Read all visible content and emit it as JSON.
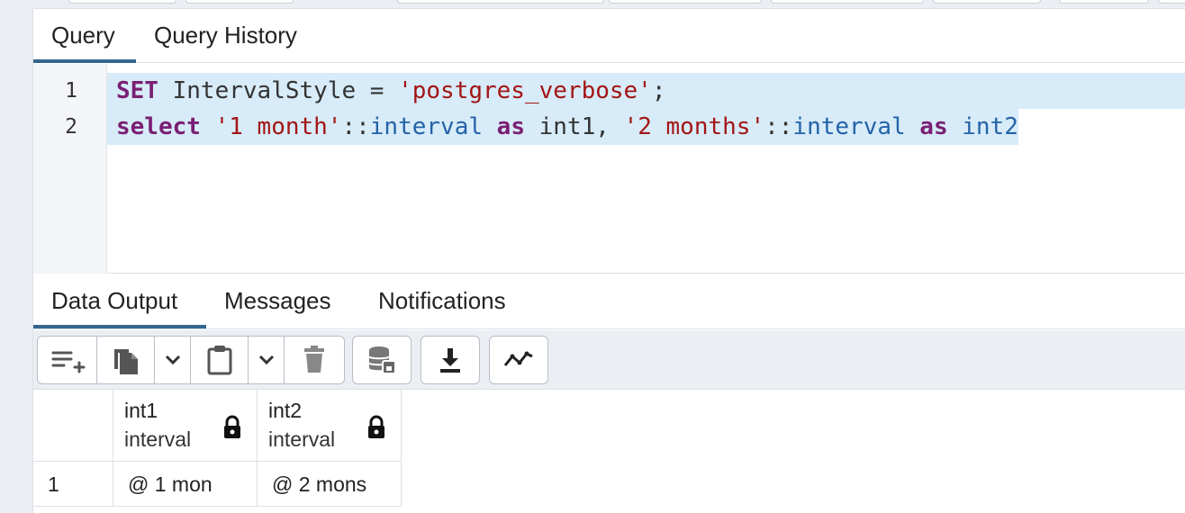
{
  "query_tabs": [
    {
      "label": "Query",
      "active": true
    },
    {
      "label": "Query History",
      "active": false
    }
  ],
  "editor": {
    "line_numbers": [
      "1",
      "2"
    ],
    "line1": {
      "kw": "SET",
      "ident": " IntervalStyle = ",
      "str": "'postgres_verbose'",
      "end": ";"
    },
    "line2": {
      "kw1": "select",
      "str1": " '1 month'",
      "op1": "::",
      "typ1": "interval",
      "kw2": " as",
      "ident1": " int1, ",
      "str2": "'2 months'",
      "op2": "::",
      "typ2": "interval",
      "kw3": " as",
      "typ3": " int2"
    }
  },
  "result_tabs": [
    {
      "label": "Data Output",
      "active": true
    },
    {
      "label": "Messages",
      "active": false
    },
    {
      "label": "Notifications",
      "active": false
    }
  ],
  "toolbar": {
    "icons": [
      "add-row-icon",
      "copy-icon",
      "chevron-down-icon",
      "paste-icon",
      "chevron-down-icon",
      "delete-icon",
      "save-data-icon",
      "download-icon",
      "graph-icon"
    ]
  },
  "grid": {
    "columns": [
      {
        "name": "int1",
        "type": "interval"
      },
      {
        "name": "int2",
        "type": "interval"
      }
    ],
    "rows": [
      {
        "num": "1",
        "values": [
          "@ 1 mon",
          "@ 2 mons"
        ]
      }
    ]
  },
  "colors": {
    "accent": "#326690",
    "selection": "#d7ebf8",
    "keyword": "#7a1f73",
    "string": "#a31515",
    "type": "#2463a8"
  }
}
